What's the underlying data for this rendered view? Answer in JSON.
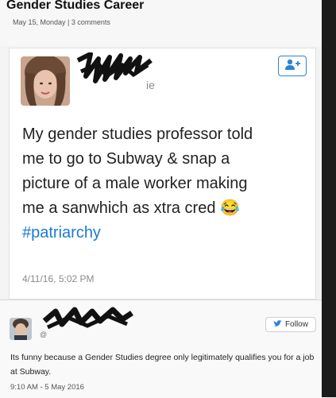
{
  "post": {
    "title": "Gender Studies Career",
    "meta": "May 15, Monday | 3 comments"
  },
  "tweet": {
    "name_fragment": "ie",
    "text_line1": "My gender studies professor told",
    "text_line2": "me to go to Subway & snap a",
    "text_line3": "picture of a male worker making",
    "text_line4": "me a sanwhich as xtra cred",
    "emoji": "😂",
    "hashtag": "#patriarchy",
    "timestamp": "4/11/16, 5:02 PM",
    "follow_icon": "add-user-icon"
  },
  "reply": {
    "handle_fragment": "@",
    "follow_label": "Follow",
    "text": "Its funny because a Gender Studies degree only legitimately qualifies you for a job at Subway.",
    "timestamp": "9:10 AM - 5 May 2016"
  },
  "colors": {
    "link": "#1b7bd3",
    "follow_border": "#2a84d6",
    "background": "#f3f3f3"
  }
}
